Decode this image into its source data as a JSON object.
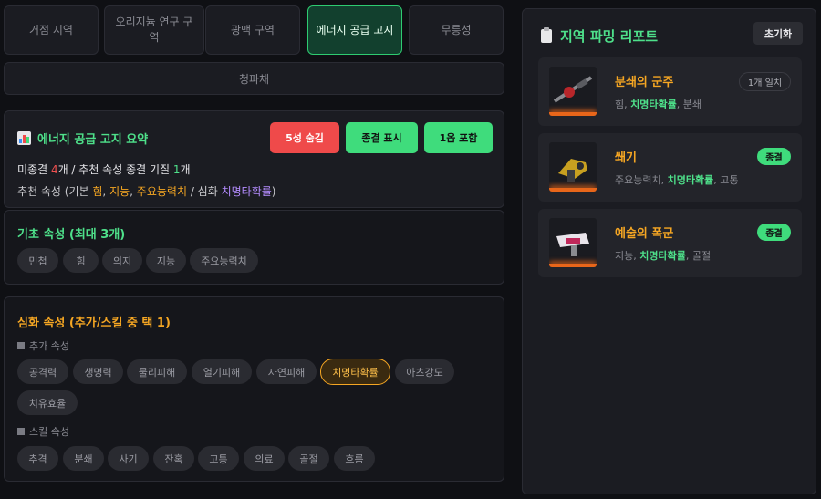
{
  "tabs": [
    "거점 지역",
    "오리지늄 연구 구역",
    "광맥 구역",
    "에너지 공급 고지",
    "무릉성"
  ],
  "tab_wide": "청파채",
  "summary": {
    "title": "에너지 공급 고지 요약",
    "btn_hide5": "5성 숨김",
    "btn_final": "종결 표시",
    "btn_include": "1옵 포함",
    "line1_a": "미종결 ",
    "line1_b": "4",
    "line1_c": "개 / 추천 속성 종결 기질 ",
    "line1_d": "1",
    "line1_e": "개",
    "line2_a": "추천 속성 (기본 ",
    "line2_b": "힘",
    "line2_c": ", ",
    "line2_d": "지능",
    "line2_e": ", ",
    "line2_f": "주요능력치",
    "line2_g": " / 심화 ",
    "line2_h": "치명타확률",
    "line2_i": ")"
  },
  "basic": {
    "title": "기초 속성 (최대 3개)",
    "chips": [
      "민첩",
      "힘",
      "의지",
      "지능",
      "주요능력치"
    ]
  },
  "advanced": {
    "title": "심화 속성 (추가/스킬 중 택 1)",
    "extra_label": "추가 속성",
    "extra_chips": [
      "공격력",
      "생명력",
      "물리피해",
      "열기피해",
      "자연피해",
      "치명타확률",
      "아츠강도",
      "치유효율"
    ],
    "skill_label": "스킬 속성",
    "skill_chips": [
      "추격",
      "분쇄",
      "사기",
      "잔혹",
      "고통",
      "의료",
      "골절",
      "흐름"
    ]
  },
  "report": {
    "title": "지역 파밍 리포트",
    "reset": "초기화",
    "cards": [
      {
        "name": "분쇄의 군주",
        "badge": "1개 일치",
        "a1": "힘",
        "a2": "치명타확률",
        "a3": "분쇄"
      },
      {
        "name": "쐐기",
        "badge": "종결",
        "a1": "주요능력치",
        "a2": "치명타확률",
        "a3": "고통"
      },
      {
        "name": "예술의 폭군",
        "badge": "종결",
        "a1": "지능",
        "a2": "치명타확률",
        "a3": "골절"
      }
    ]
  },
  "colors": {
    "accent_green": "#4ee08a",
    "accent_orange": "#f5a623",
    "accent_red": "#ef4a4a",
    "accent_purple": "#b48cff"
  }
}
